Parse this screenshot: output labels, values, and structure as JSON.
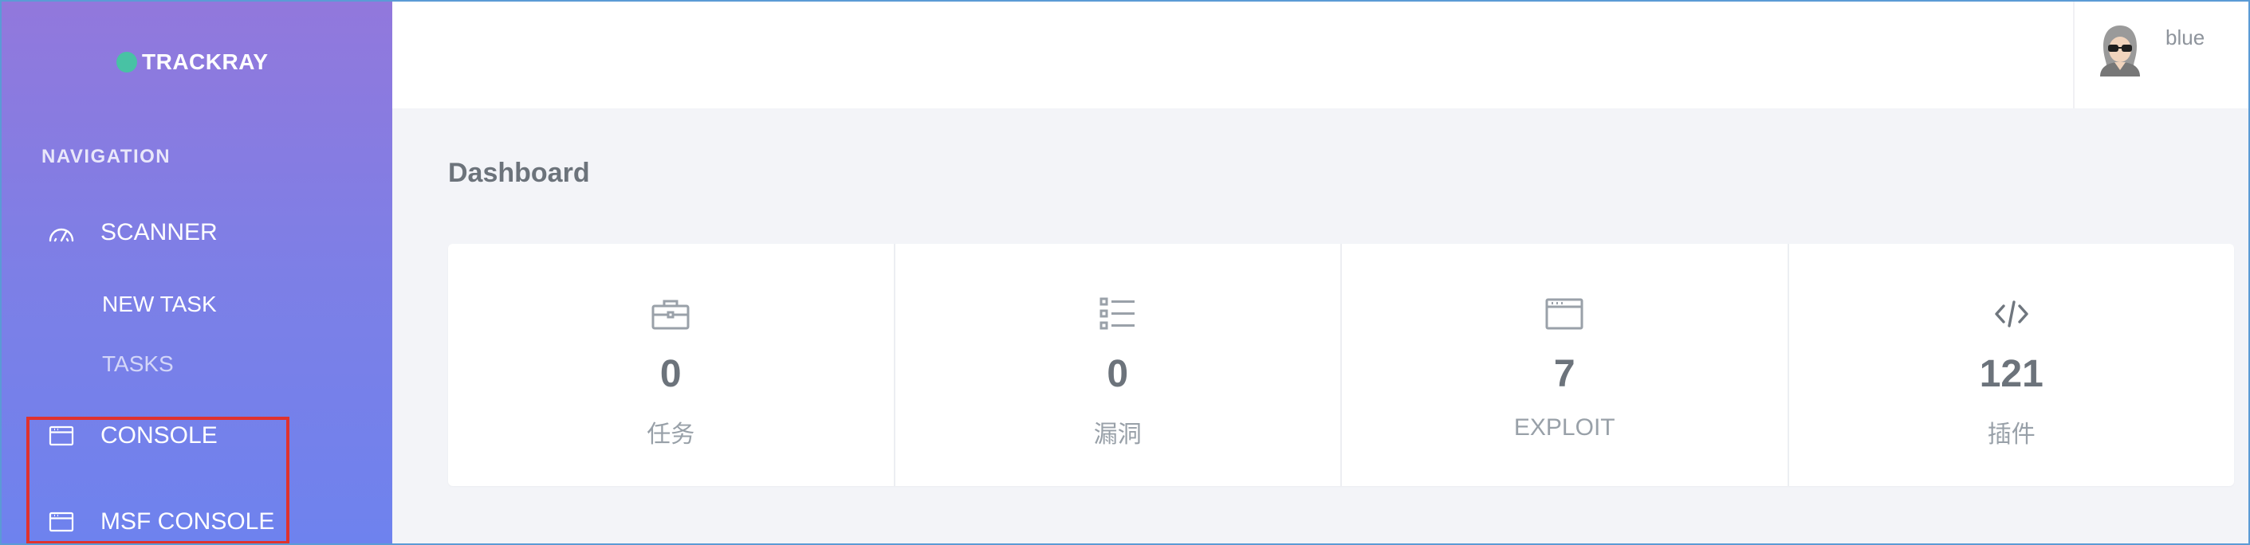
{
  "brand": {
    "name": "TRACKRAY",
    "dot_color": "#48c2a4"
  },
  "sidebar": {
    "heading": "NAVIGATION",
    "items": [
      {
        "label": "SCANNER",
        "icon": "speedometer-icon"
      },
      {
        "label": "CONSOLE",
        "icon": "browser-window-icon"
      },
      {
        "label": "MSF CONSOLE",
        "icon": "browser-window-icon"
      }
    ],
    "sub_items": [
      {
        "label": "NEW TASK"
      },
      {
        "label": "TASKS"
      }
    ],
    "gradient_top": "#9278dc",
    "gradient_bottom": "#6e82ee"
  },
  "header": {
    "username": "blue"
  },
  "main": {
    "title": "Dashboard",
    "stats": [
      {
        "value": "0",
        "label": "任务",
        "icon": "briefcase-icon"
      },
      {
        "value": "0",
        "label": "漏洞",
        "icon": "list-icon"
      },
      {
        "value": "7",
        "label": "EXPLOIT",
        "icon": "browser-window-icon"
      },
      {
        "value": "121",
        "label": "插件",
        "icon": "code-icon"
      }
    ]
  },
  "highlight": {
    "color": "#e0322e"
  }
}
